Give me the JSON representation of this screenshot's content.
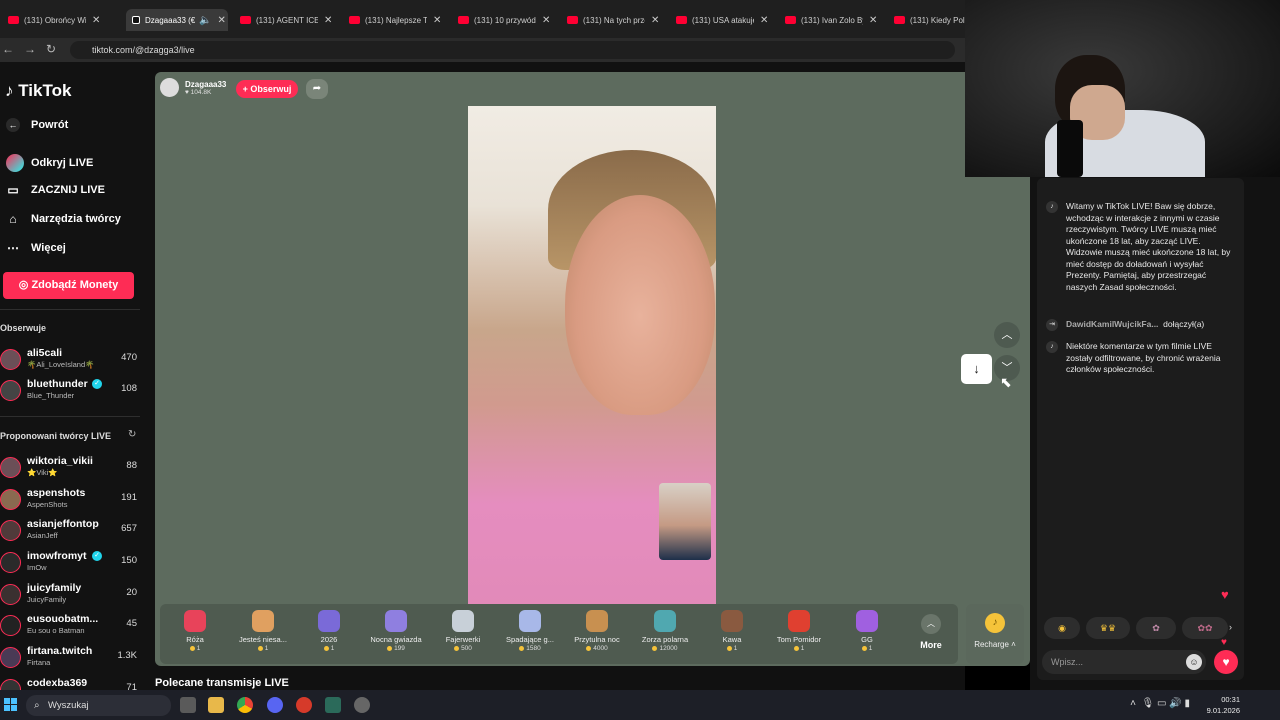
{
  "browser": {
    "tabs": [
      {
        "label": "(131) Obrońcy Wi"
      },
      {
        "label": "Dzagaaa33 (€"
      },
      {
        "label": "(131) AGENT ICE"
      },
      {
        "label": "(131) Najlepsze Te"
      },
      {
        "label": "(131) 10 przywód"
      },
      {
        "label": "(131) Na tych prze"
      },
      {
        "label": "(131) USA atakuje"
      },
      {
        "label": "(131) Ivan Zolo By"
      },
      {
        "label": "(131) Kiedy Poli"
      }
    ],
    "url": "tiktok.com/@dzagga3/live"
  },
  "sidebar": {
    "logo": "TikTok",
    "nav": [
      {
        "label": "Powrót",
        "icon": "←"
      },
      {
        "label": "Odkryj LIVE",
        "icon": "◉"
      },
      {
        "label": "ZACZNIJ LIVE",
        "icon": "▭"
      },
      {
        "label": "Narzędzia twórcy",
        "icon": "⌂"
      },
      {
        "label": "Więcej",
        "icon": "⋯"
      }
    ],
    "coins_button": "Zdobądź Monety",
    "following_label": "Obserwuje",
    "following": [
      {
        "name": "ali5cali",
        "sub": "🌴Ali_LoveIsland🌴",
        "count": "470"
      },
      {
        "name": "bluethunder",
        "sub": "Blue_Thunder",
        "count": "108"
      }
    ],
    "suggested_label": "Proponowani twórcy LIVE",
    "suggested": [
      {
        "name": "wiktoria_vikii",
        "sub": "⭐Viki⭐",
        "count": "88"
      },
      {
        "name": "aspenshots",
        "sub": "AspenShots",
        "count": "191"
      },
      {
        "name": "asianjeffontop",
        "sub": "AsianJeff",
        "count": "657"
      },
      {
        "name": "imowfromyt",
        "sub": "ImOw",
        "count": "150"
      },
      {
        "name": "juicyfamily",
        "sub": "JuicyFamily",
        "count": "20"
      },
      {
        "name": "eusouobatm...",
        "sub": "Eu sou o Batman",
        "count": "45"
      },
      {
        "name": "firtana.twitch",
        "sub": "Firtana",
        "count": "1.3K"
      },
      {
        "name": "codexba369",
        "sub": "",
        "count": "71"
      }
    ]
  },
  "stream": {
    "host_name": "Dzagaaa33",
    "host_likes": "104.8K",
    "follow_label": "+ Obserwuj",
    "recommended_label": "Polecane transmisje LIVE"
  },
  "gifts": [
    {
      "name": "Róża",
      "price": "1",
      "color": "#e8435a"
    },
    {
      "name": "Jesteś niesa...",
      "price": "1",
      "color": "#e0a060"
    },
    {
      "name": "2026",
      "price": "1",
      "color": "#7a6ad8"
    },
    {
      "name": "Nocna gwiazda",
      "price": "199",
      "color": "#8f7fe0"
    },
    {
      "name": "Fajerwerki",
      "price": "500",
      "color": "#c8d0d8"
    },
    {
      "name": "Spadające g...",
      "price": "1580",
      "color": "#a8b8e8"
    },
    {
      "name": "Przytulna noc",
      "price": "4000",
      "color": "#c89050"
    },
    {
      "name": "Zorza polarna",
      "price": "12000",
      "color": "#50a8b0"
    },
    {
      "name": "Kawa",
      "price": "1",
      "color": "#8a5a40"
    },
    {
      "name": "Tom Pomidor",
      "price": "1",
      "color": "#e04030"
    },
    {
      "name": "GG",
      "price": "1",
      "color": "#a060e0"
    }
  ],
  "gift_more": "More",
  "recharge": "Recharge",
  "chat": {
    "welcome": "Witamy w TikTok LIVE! Baw się dobrze, wchodząc w interakcje z innymi w czasie rzeczywistym. Twórcy LIVE muszą mieć ukończone 18 lat, aby zacząć LIVE. Widzowie muszą mieć ukończone 18 lat, by mieć dostęp do doładowań i wysyłać Prezenty. Pamiętaj, aby przestrzegać naszych Zasad społeczności.",
    "join_user": "DawidKamilWujcikFa...",
    "join_text": "dołączył(a)",
    "filtered": "Niektóre komentarze w tym filmie LIVE zostały odfiltrowane, by chronić wrażenia członków społeczności.",
    "input_placeholder": "Wpisz..."
  },
  "taskbar": {
    "search": "Wyszukaj",
    "time": "00:31",
    "date": "9.01.2026"
  },
  "colors": {
    "accent": "#fe2c55",
    "stream_bg": "#5d6b5e",
    "coin": "#f5c33a"
  }
}
